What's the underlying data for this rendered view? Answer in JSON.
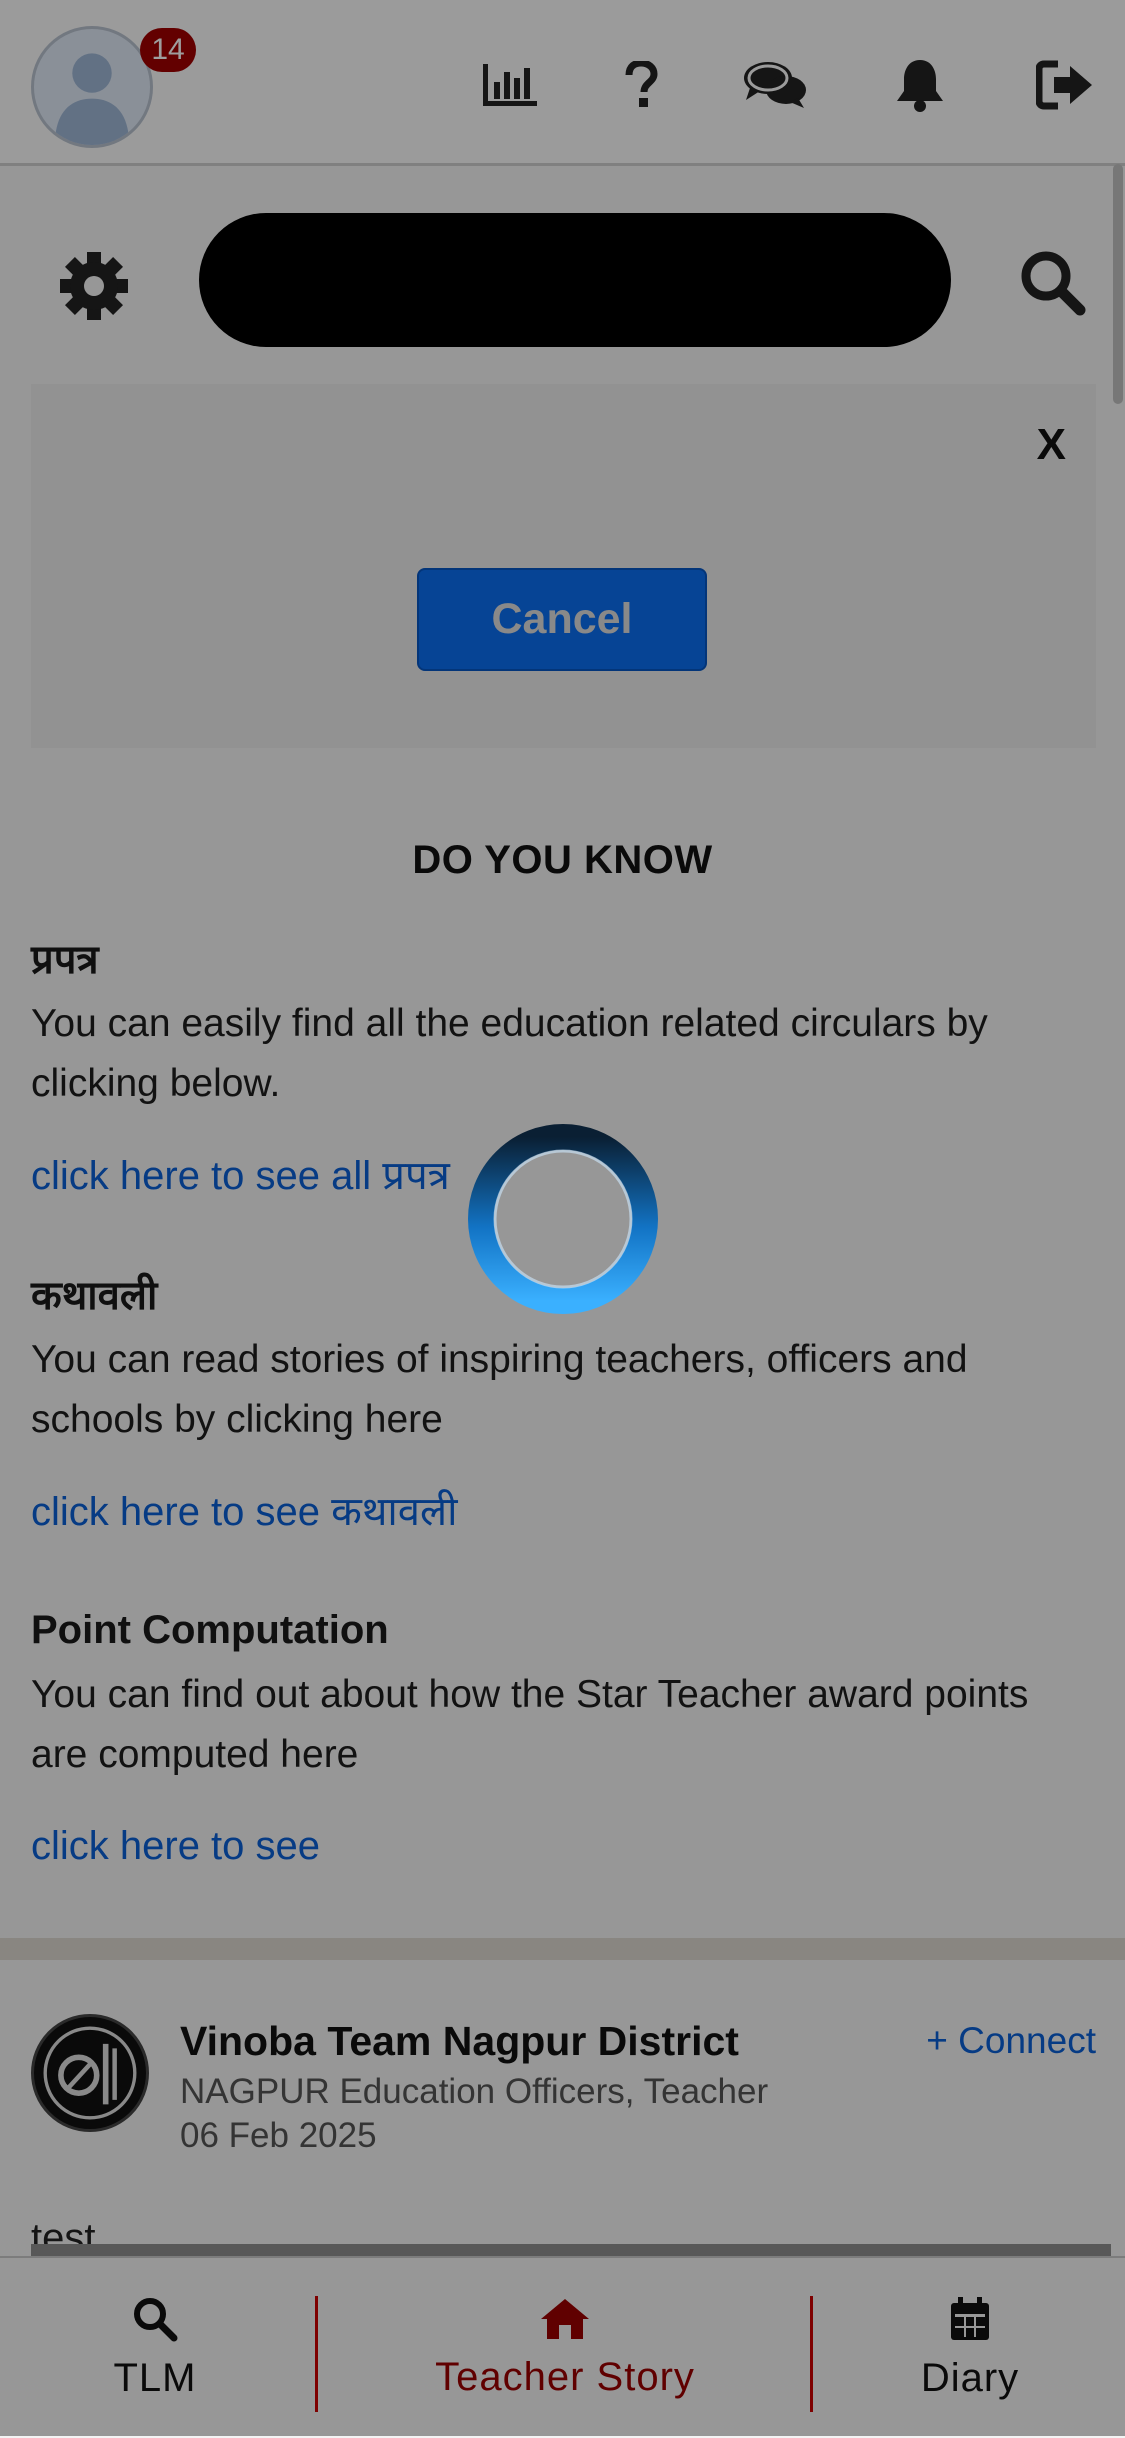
{
  "header": {
    "notification_count": "14",
    "icons": [
      "bar-chart-icon",
      "help-icon",
      "chat-icon",
      "bell-icon",
      "logout-icon"
    ]
  },
  "banner": {
    "close_label": "X",
    "cancel_label": "Cancel"
  },
  "do_you_know": {
    "title": "DO YOU KNOW",
    "sections": [
      {
        "title": "प्रपत्र",
        "text": "You can easily find all the education related circulars by clicking below.",
        "link": "click here to see all प्रपत्र"
      },
      {
        "title": "कथावली",
        "text": "You can read stories of inspiring teachers, officers and schools by clicking here",
        "link": "click here to see कथावली"
      },
      {
        "title": "Point Computation",
        "text": "You can find out about how the Star Teacher award points are computed here",
        "link": "click here to see"
      }
    ]
  },
  "post": {
    "author": "Vinoba Team Nagpur District",
    "role": "NAGPUR Education Officers, Teacher",
    "date": "06 Feb 2025",
    "connect_label": "+ Connect",
    "text": "test"
  },
  "bottom_nav": {
    "items": [
      {
        "label": "TLM",
        "icon": "search-icon",
        "active": false
      },
      {
        "label": "Teacher Story",
        "icon": "home-icon",
        "active": true
      },
      {
        "label": "Diary",
        "icon": "calendar-icon",
        "active": false
      }
    ]
  },
  "colors": {
    "accent_blue": "#0b5fd6",
    "active_red": "#9b0000",
    "badge_red": "#a10000"
  }
}
